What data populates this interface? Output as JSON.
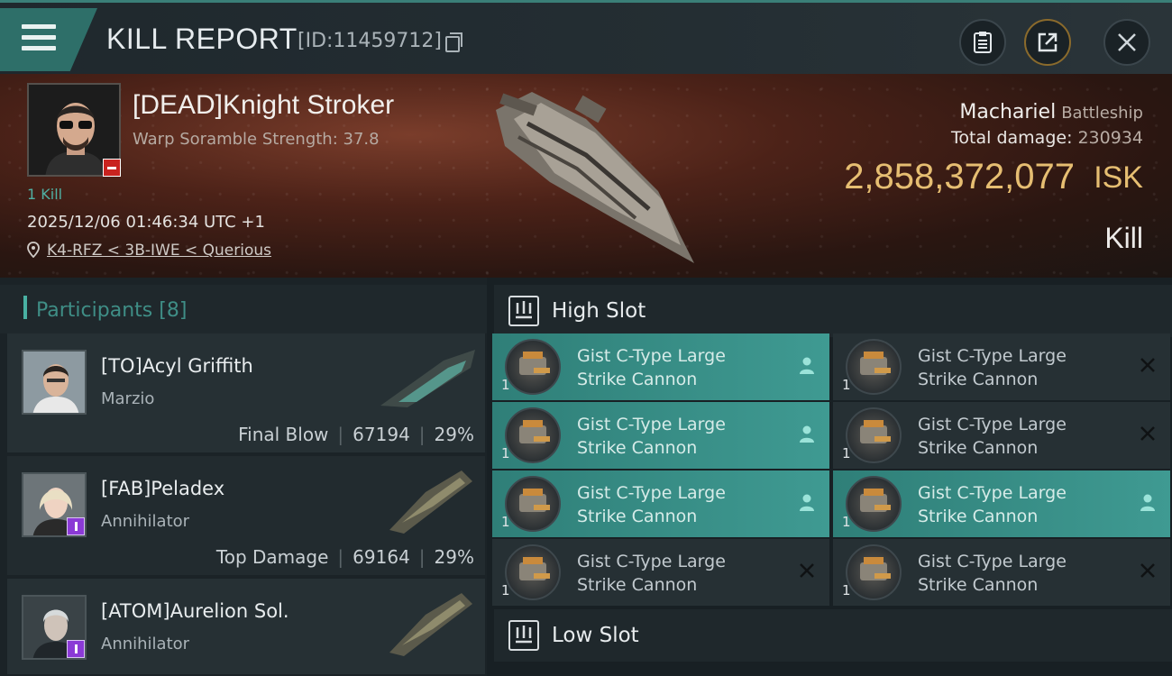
{
  "header": {
    "title": "KILL REPORT",
    "report_id": "[ID:11459712]"
  },
  "victim": {
    "name": "[DEAD]Knight Stroker",
    "warp_strength": "Warp Soramble Strength: 37.8",
    "kill_count": "1 Kill",
    "timestamp": "2025/12/06 01:46:34 UTC +1",
    "location": "K4-RFZ < 3B-IWE < Querious"
  },
  "ship": {
    "name": "Machariel",
    "class": "Battleship",
    "total_damage_label": "Total damage:",
    "total_damage_value": "230934",
    "isk_value": "2,858,372,077",
    "isk_label": "ISK",
    "result": "Kill"
  },
  "participants": {
    "title": "Participants",
    "count": "[8]",
    "items": [
      {
        "name": "[TO]Acyl Griffith",
        "ship": "Marzio",
        "role": "Final Blow",
        "damage": "67194",
        "percent": "29%"
      },
      {
        "name": "[FAB]Peladex",
        "ship": "Annihilator",
        "role": "Top Damage",
        "damage": "69164",
        "percent": "29%"
      },
      {
        "name": "[ATOM]Aurelion Sol.",
        "ship": "Annihilator"
      }
    ]
  },
  "fitting": {
    "high_slot_title": "High Slot",
    "low_slot_title": "Low Slot",
    "modules": [
      {
        "name_line1": "Gist C-Type Large",
        "name_line2": "Strike Cannon",
        "qty": "1",
        "status": "fitted"
      },
      {
        "name_line1": "Gist C-Type Large",
        "name_line2": "Strike Cannon",
        "qty": "1",
        "status": "destroyed"
      },
      {
        "name_line1": "Gist C-Type Large",
        "name_line2": "Strike Cannon",
        "qty": "1",
        "status": "fitted"
      },
      {
        "name_line1": "Gist C-Type Large",
        "name_line2": "Strike Cannon",
        "qty": "1",
        "status": "destroyed"
      },
      {
        "name_line1": "Gist C-Type Large",
        "name_line2": "Strike Cannon",
        "qty": "1",
        "status": "fitted"
      },
      {
        "name_line1": "Gist C-Type Large",
        "name_line2": "Strike Cannon",
        "qty": "1",
        "status": "fitted"
      },
      {
        "name_line1": "Gist C-Type Large",
        "name_line2": "Strike Cannon",
        "qty": "1",
        "status": "destroyed"
      },
      {
        "name_line1": "Gist C-Type Large",
        "name_line2": "Strike Cannon",
        "qty": "1",
        "status": "destroyed"
      }
    ]
  },
  "icons": {
    "menu": "hamburger-menu-icon",
    "copy": "copy-icon",
    "report": "clipboard-icon",
    "share": "share-icon",
    "close": "close-icon",
    "location": "location-pin-icon",
    "dropped": "person-icon",
    "destroyed": "x-icon"
  },
  "colors": {
    "accent": "#3f9a92",
    "isk": "#e6be72",
    "dead_badge": "#c9231f",
    "module_fitted": "#3f9a92"
  }
}
